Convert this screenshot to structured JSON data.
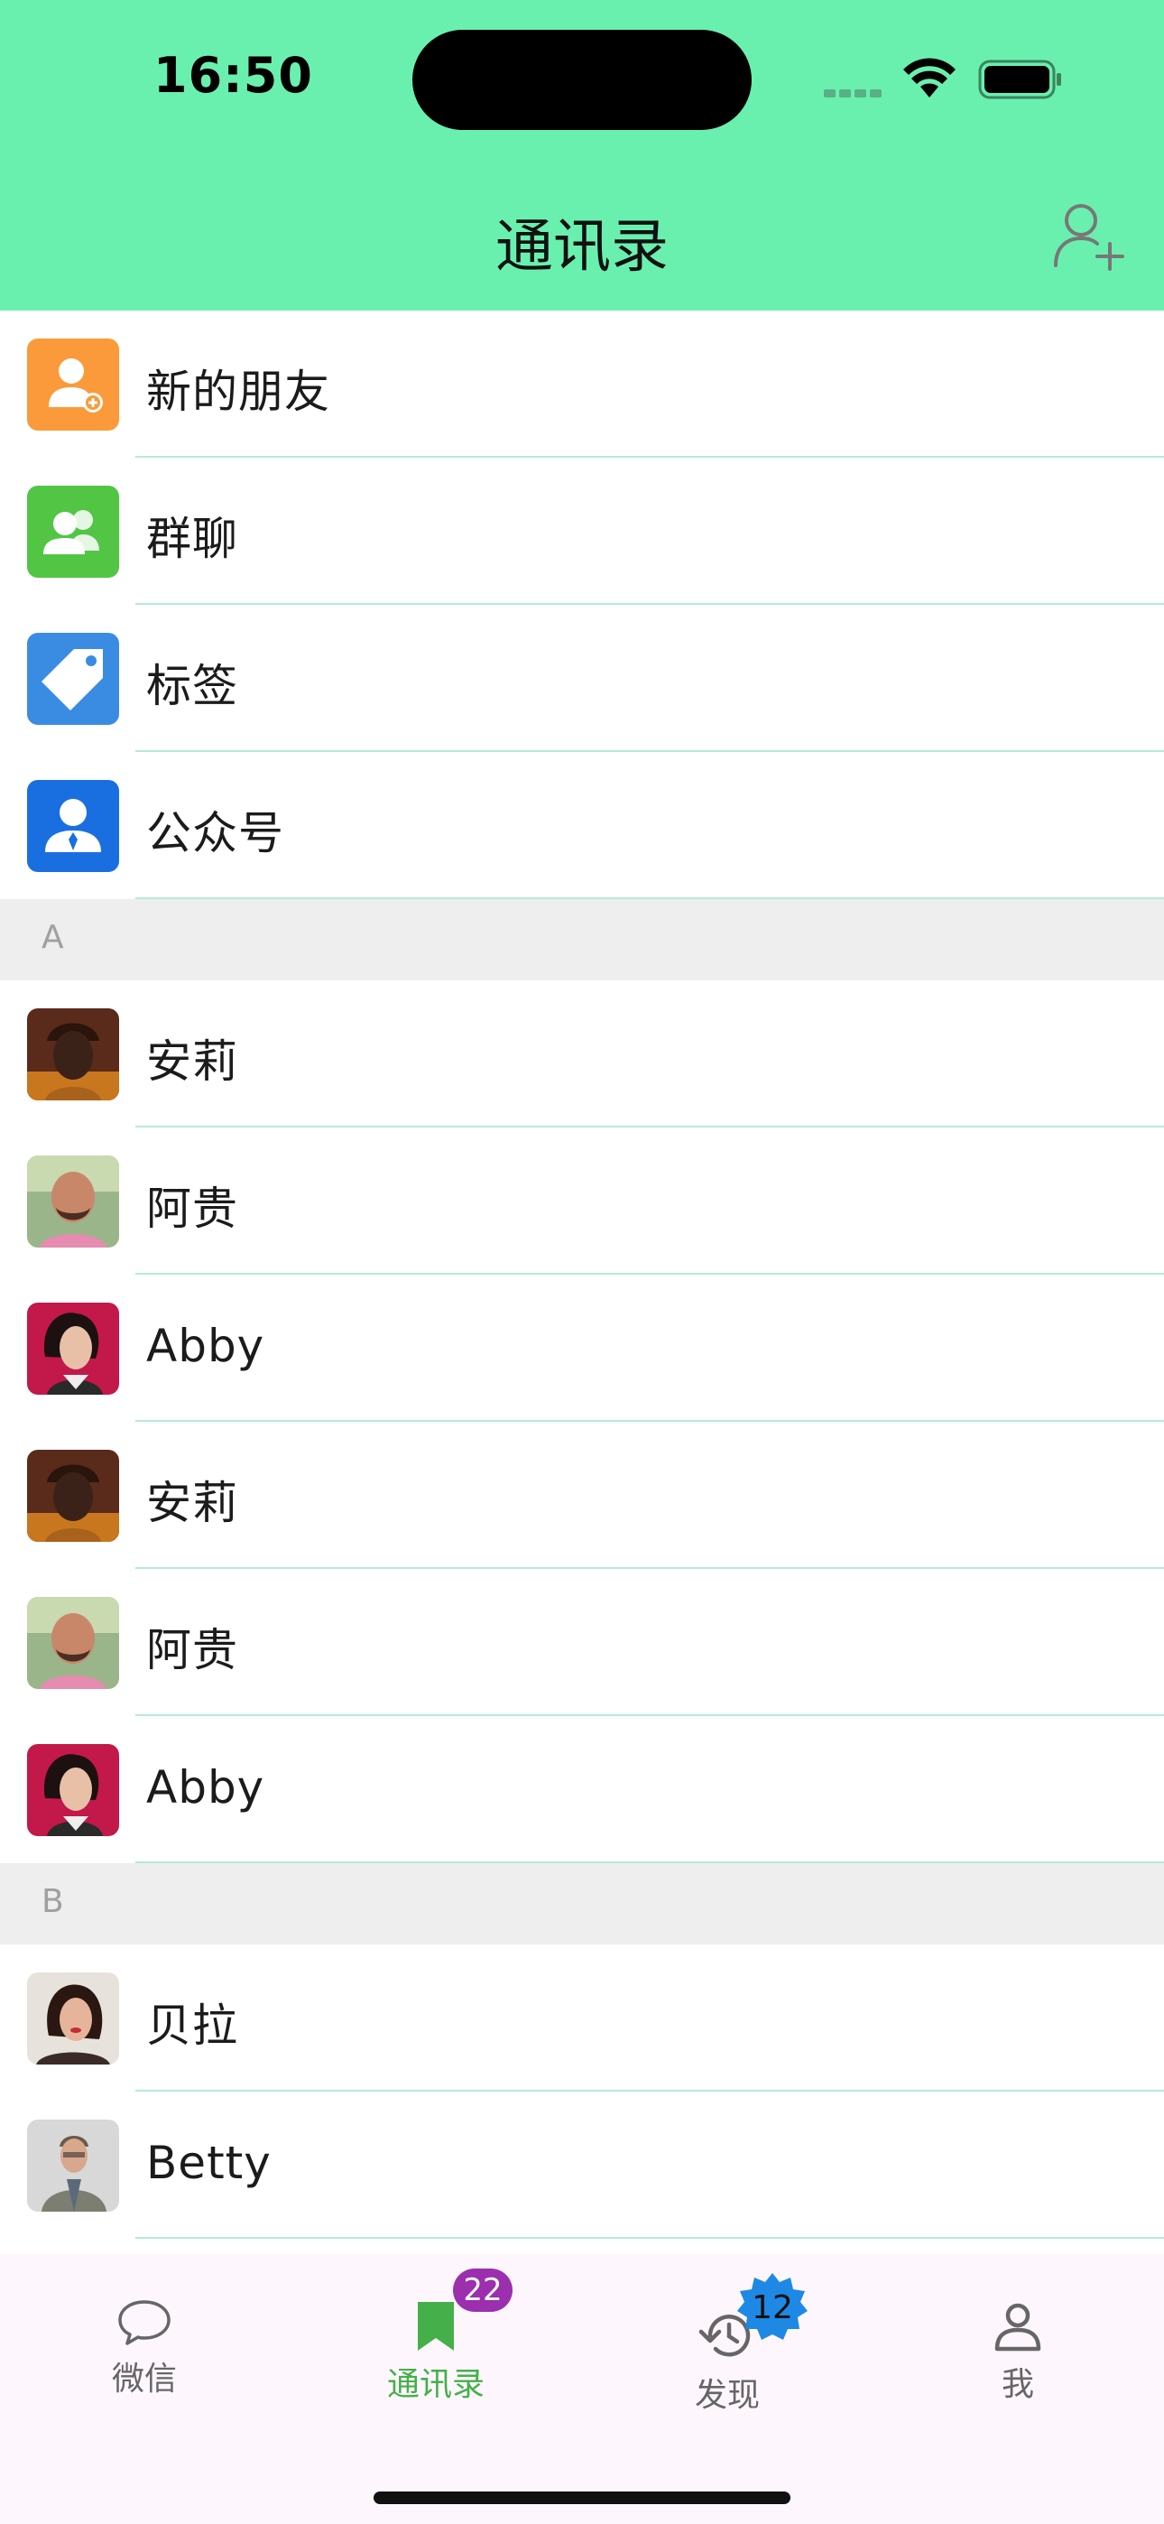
{
  "status_bar": {
    "time": "16:50"
  },
  "header": {
    "title": "通讯录",
    "add_icon": "person-add-icon"
  },
  "colors": {
    "header_bg": "#6af0ae",
    "divider": "#b4ecd4",
    "active_tab": "#45b04a",
    "badge_purple": "#9b2fae",
    "badge_blue": "#1e88e5"
  },
  "functions": [
    {
      "label": "新的朋友",
      "icon": "new-friend-icon",
      "color": "#fb9a3a"
    },
    {
      "label": "群聊",
      "icon": "group-chat-icon",
      "color": "#52c545"
    },
    {
      "label": "标签",
      "icon": "tag-icon",
      "color": "#3a8ce3"
    },
    {
      "label": "公众号",
      "icon": "official-account-icon",
      "color": "#1a6fe0"
    }
  ],
  "sections": [
    {
      "letter": "A",
      "contacts": [
        {
          "name": "安莉"
        },
        {
          "name": "阿贵"
        },
        {
          "name": "Abby"
        },
        {
          "name": "安莉"
        },
        {
          "name": "阿贵"
        },
        {
          "name": "Abby"
        }
      ]
    },
    {
      "letter": "B",
      "contacts": [
        {
          "name": "贝拉"
        },
        {
          "name": "Betty"
        }
      ]
    }
  ],
  "tabs": [
    {
      "label": "微信",
      "icon": "chat-bubble-icon",
      "active": false
    },
    {
      "label": "通讯录",
      "icon": "bookmark-icon",
      "active": true,
      "badge": "22"
    },
    {
      "label": "发现",
      "icon": "history-icon",
      "active": false,
      "badge": "12"
    },
    {
      "label": "我",
      "icon": "person-icon",
      "active": false
    }
  ]
}
